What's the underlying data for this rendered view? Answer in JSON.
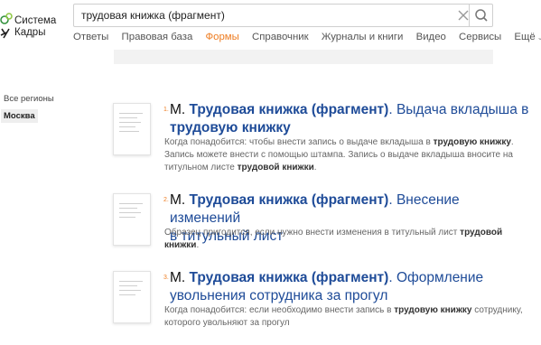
{
  "logo": {
    "line1": "Система",
    "line2": "Кадры"
  },
  "search": {
    "value": "трудовая книжка (фрагмент)"
  },
  "nav": [
    "Ответы",
    "Правовая база",
    "Формы",
    "Справочник",
    "Журналы и книги",
    "Видео",
    "Сервисы",
    "Ещё"
  ],
  "nav_active": "Формы",
  "sidebar": {
    "regions_label": "Все регионы",
    "selected_region": "Москва"
  },
  "results": [
    {
      "num": "1.",
      "prefix": "М.",
      "bold": "Трудовая книжка",
      "bold2": "(фрагмент)",
      "rest": ". Выдача вкладыша в",
      "line2_bold": "трудовую книжку",
      "desc_parts": [
        "Когда понадобится: чтобы внести запись о выдаче вкладыша в ",
        "трудовую книжку",
        ". Запись можете внести с помощью штампа. Запись о выдаче вкладыша вносите на титульном листе ",
        "трудовой книжки",
        "."
      ]
    },
    {
      "num": "2.",
      "prefix": "М.",
      "bold": "Трудовая книжка",
      "bold2": "(фрагмент)",
      "rest": ". Внесение изменений",
      "line2": "в титульный лист",
      "desc_parts": [
        "Образец пригодится, если нужно внести изменения в титульный лист ",
        "трудовой книжки",
        "."
      ]
    },
    {
      "num": "3.",
      "prefix": "М.",
      "bold": "Трудовая книжка",
      "bold2": "(фрагмент)",
      "rest": ". Оформление",
      "line2": "увольнения сотрудника за прогул",
      "desc_parts": [
        "Когда понадобится: если необходимо внести запись в ",
        "трудовую книжку",
        " сотруднику, которого увольняют за прогул"
      ]
    }
  ]
}
